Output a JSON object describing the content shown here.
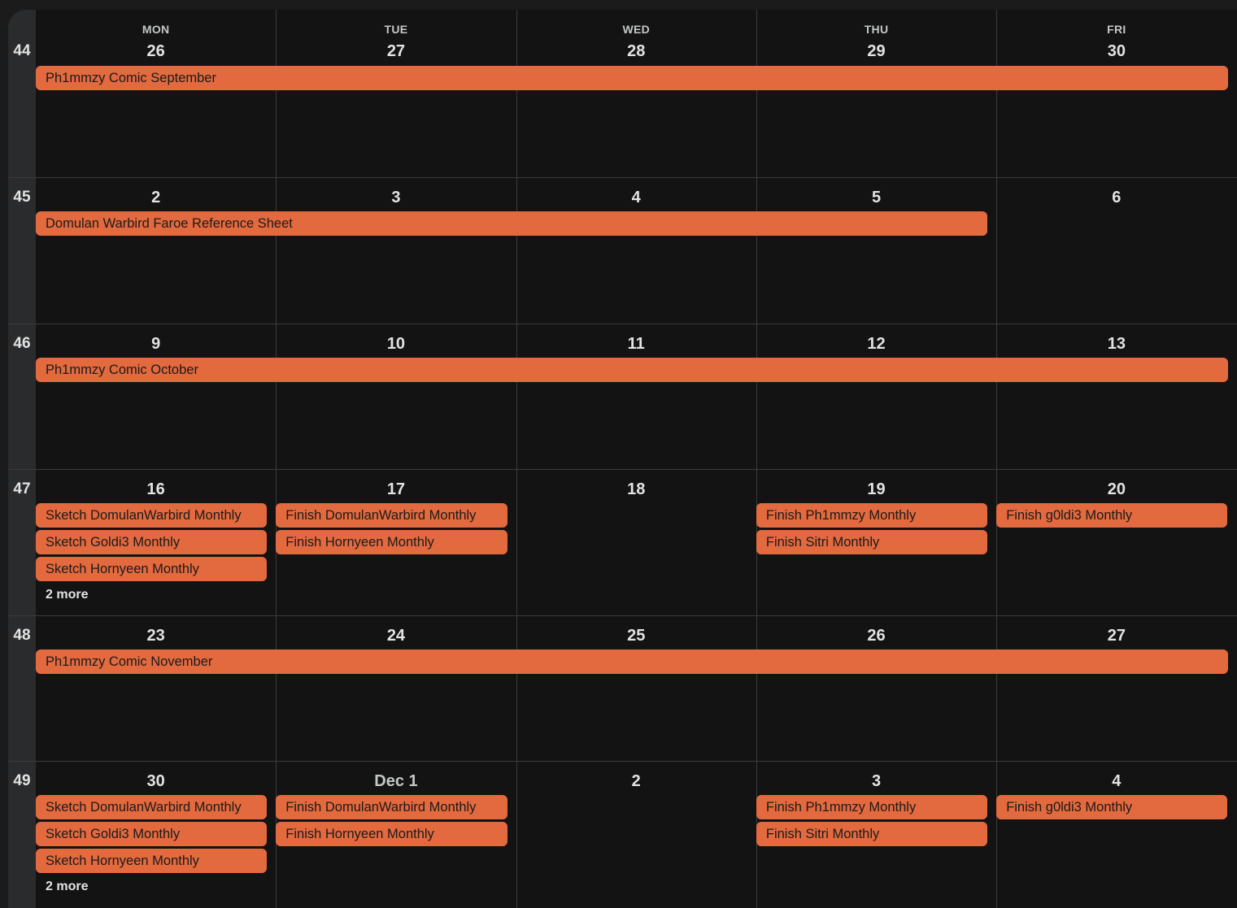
{
  "calendar": {
    "weekdays": [
      "MON",
      "TUE",
      "WED",
      "THU",
      "FRI"
    ],
    "weeks": [
      {
        "number": "44",
        "days": [
          "26",
          "27",
          "28",
          "29",
          "30"
        ],
        "events": [
          {
            "title": "Ph1mmzy Comic September",
            "start": 0,
            "span": 5,
            "slot": 0
          }
        ],
        "more": []
      },
      {
        "number": "45",
        "days": [
          "2",
          "3",
          "4",
          "5",
          "6"
        ],
        "events": [
          {
            "title": "Domulan Warbird Faroe Reference Sheet",
            "start": 0,
            "span": 4,
            "slot": 0
          }
        ],
        "more": []
      },
      {
        "number": "46",
        "days": [
          "9",
          "10",
          "11",
          "12",
          "13"
        ],
        "events": [
          {
            "title": "Ph1mmzy Comic October",
            "start": 0,
            "span": 5,
            "slot": 0
          }
        ],
        "more": []
      },
      {
        "number": "47",
        "days": [
          "16",
          "17",
          "18",
          "19",
          "20"
        ],
        "events": [
          {
            "title": "Sketch DomulanWarbird Monthly",
            "start": 0,
            "span": 1,
            "slot": 0
          },
          {
            "title": "Sketch Goldi3 Monthly",
            "start": 0,
            "span": 1,
            "slot": 1
          },
          {
            "title": "Sketch Hornyeen Monthly",
            "start": 0,
            "span": 1,
            "slot": 2
          },
          {
            "title": "Finish DomulanWarbird Monthly",
            "start": 1,
            "span": 1,
            "slot": 0
          },
          {
            "title": "Finish Hornyeen Monthly",
            "start": 1,
            "span": 1,
            "slot": 1
          },
          {
            "title": "Finish Ph1mmzy Monthly",
            "start": 3,
            "span": 1,
            "slot": 0
          },
          {
            "title": "Finish Sitri Monthly",
            "start": 3,
            "span": 1,
            "slot": 1
          },
          {
            "title": "Finish g0ldi3 Monthly",
            "start": 4,
            "span": 1,
            "slot": 0
          }
        ],
        "more": [
          {
            "label": "2 more",
            "day": 0,
            "slot": 3
          }
        ]
      },
      {
        "number": "48",
        "days": [
          "23",
          "24",
          "25",
          "26",
          "27"
        ],
        "events": [
          {
            "title": "Ph1mmzy Comic November",
            "start": 0,
            "span": 5,
            "slot": 0
          }
        ],
        "more": []
      },
      {
        "number": "49",
        "days": [
          "30",
          "Dec 1",
          "2",
          "3",
          "4"
        ],
        "events": [
          {
            "title": "Sketch DomulanWarbird Monthly",
            "start": 0,
            "span": 1,
            "slot": 0
          },
          {
            "title": "Sketch Goldi3 Monthly",
            "start": 0,
            "span": 1,
            "slot": 1
          },
          {
            "title": "Sketch Hornyeen Monthly",
            "start": 0,
            "span": 1,
            "slot": 2
          },
          {
            "title": "Finish DomulanWarbird Monthly",
            "start": 1,
            "span": 1,
            "slot": 0
          },
          {
            "title": "Finish Hornyeen Monthly",
            "start": 1,
            "span": 1,
            "slot": 1
          },
          {
            "title": "Finish Ph1mmzy Monthly",
            "start": 3,
            "span": 1,
            "slot": 0
          },
          {
            "title": "Finish Sitri Monthly",
            "start": 3,
            "span": 1,
            "slot": 1
          },
          {
            "title": "Finish g0ldi3 Monthly",
            "start": 4,
            "span": 1,
            "slot": 0
          }
        ],
        "more": [
          {
            "label": "2 more",
            "day": 0,
            "slot": 3
          }
        ]
      }
    ]
  },
  "colors": {
    "event": "#e3693e",
    "background": "#131314",
    "week_column": "#2a2b2c",
    "grid_line": "#3a3b3d"
  }
}
